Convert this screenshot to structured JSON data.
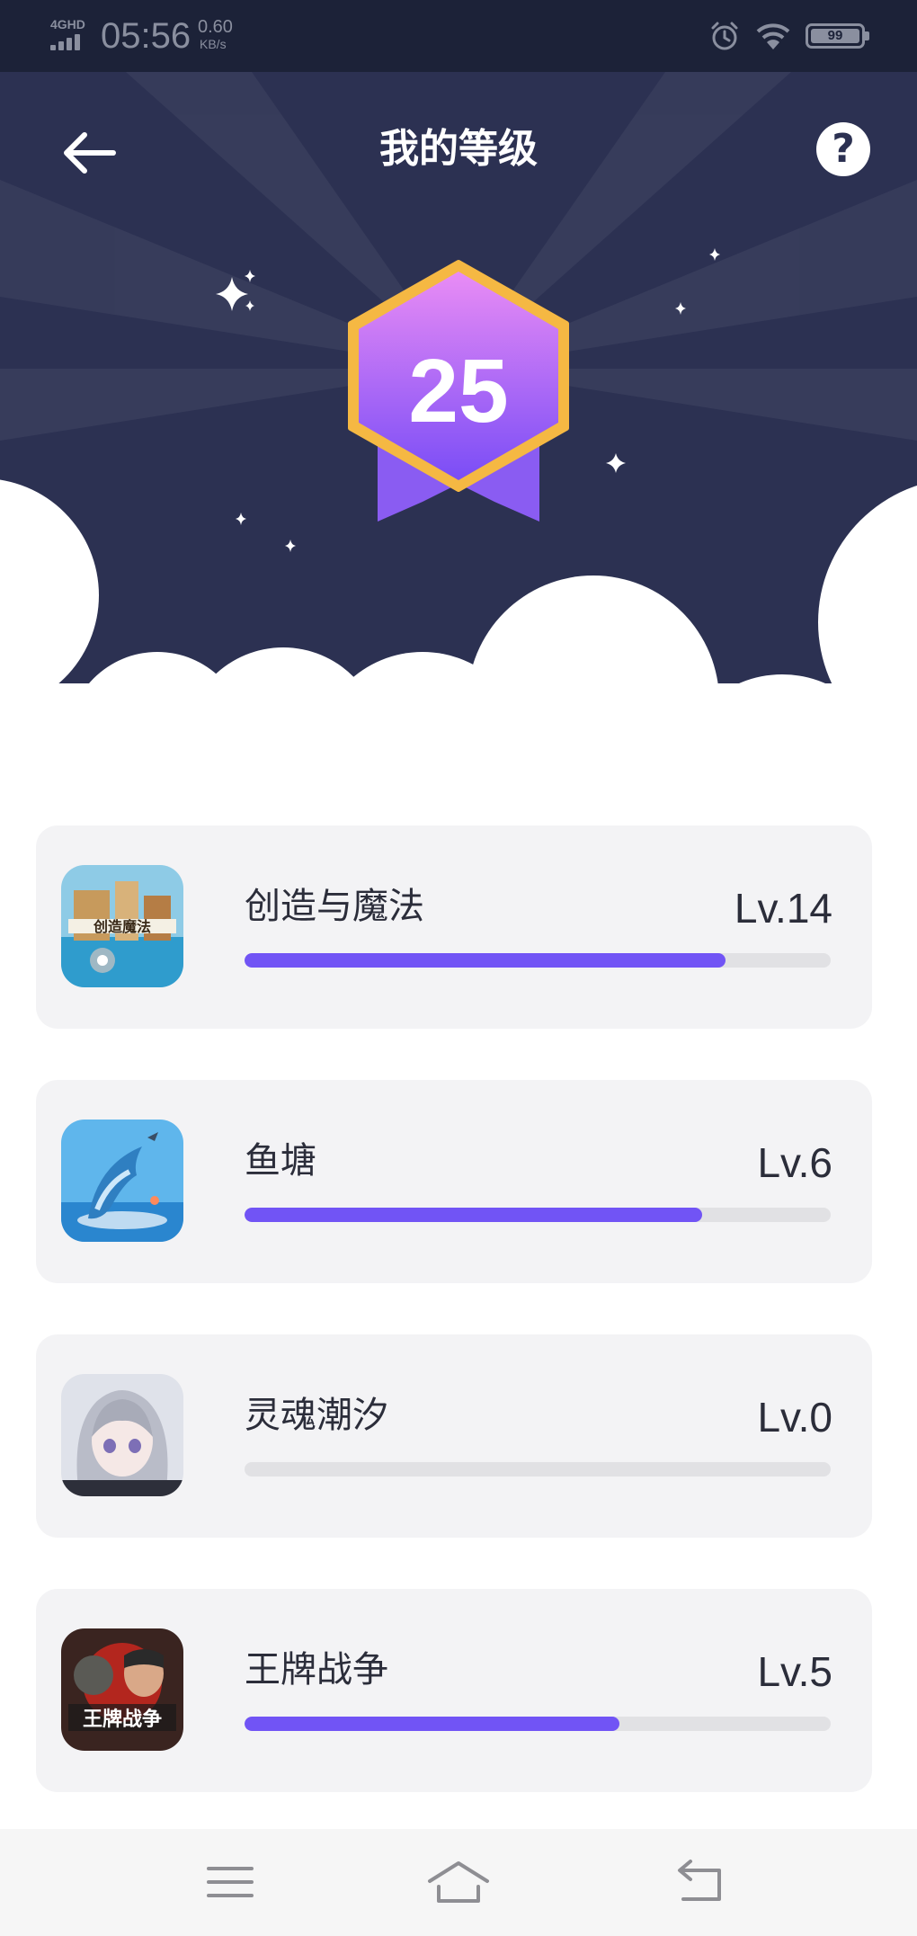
{
  "status_bar": {
    "network": "4GHD",
    "time": "05:56",
    "speed": "0.60",
    "speed_unit": "KB/s",
    "battery": "99"
  },
  "header": {
    "title": "我的等级",
    "back_icon": "arrow-left-icon",
    "help_icon": "question-icon",
    "help_label": "?"
  },
  "badge": {
    "level": "25",
    "colors": {
      "top": "#e98cf5",
      "bottom": "#7a4df6",
      "border": "#f5b843",
      "ribbon": "#8a5cf2"
    }
  },
  "games": [
    {
      "name": "创造与魔法",
      "level": "Lv.14",
      "progress": 0.82
    },
    {
      "name": "鱼塘",
      "level": "Lv.6",
      "progress": 0.78
    },
    {
      "name": "灵魂潮汐",
      "level": "Lv.0",
      "progress": 0.0
    },
    {
      "name": "王牌战争",
      "level": "Lv.5",
      "progress": 0.64
    }
  ],
  "bottom_nav": {
    "items": [
      "menu-icon",
      "home-icon",
      "back-icon"
    ]
  },
  "colors": {
    "header_bg": "#2c3152",
    "accent": "#7154f5",
    "card_bg": "#f3f3f5",
    "track": "#e1e1e4"
  }
}
